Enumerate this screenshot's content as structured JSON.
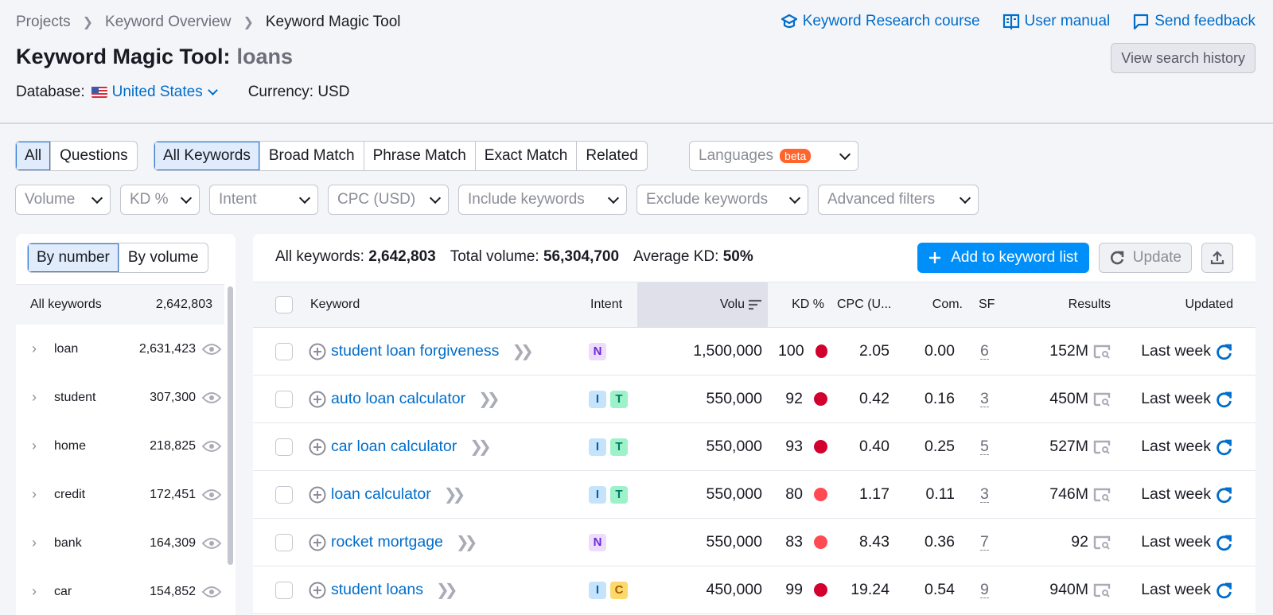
{
  "breadcrumbs": [
    "Projects",
    "Keyword Overview",
    "Keyword Magic Tool"
  ],
  "top_links": [
    {
      "label": "Keyword Research course",
      "icon": "graduation-cap-icon"
    },
    {
      "label": "User manual",
      "icon": "book-icon"
    },
    {
      "label": "Send feedback",
      "icon": "chat-bubble-icon"
    }
  ],
  "title": {
    "label": "Keyword Magic Tool:",
    "query": "loans"
  },
  "view_history_label": "View search history",
  "database": {
    "label": "Database:",
    "value": "United States",
    "currency": "Currency: USD"
  },
  "type_tabs": [
    {
      "label": "All",
      "active": true
    },
    {
      "label": "Questions",
      "active": false
    }
  ],
  "match_tabs": [
    {
      "label": "All Keywords",
      "active": true
    },
    {
      "label": "Broad Match",
      "active": false
    },
    {
      "label": "Phrase Match",
      "active": false
    },
    {
      "label": "Exact Match",
      "active": false
    },
    {
      "label": "Related",
      "active": false
    }
  ],
  "languages": {
    "label": "Languages",
    "badge": "beta"
  },
  "filters": [
    "Volume",
    "KD %",
    "Intent",
    "CPC (USD)",
    "Include keywords",
    "Exclude keywords",
    "Advanced filters"
  ],
  "left_panel": {
    "tabs": [
      {
        "label": "By number",
        "active": true
      },
      {
        "label": "By volume",
        "active": false
      }
    ],
    "all": {
      "label": "All keywords",
      "count": "2,642,803"
    },
    "groups": [
      {
        "label": "loan",
        "count": "2,631,423"
      },
      {
        "label": "student",
        "count": "307,300"
      },
      {
        "label": "home",
        "count": "218,825"
      },
      {
        "label": "credit",
        "count": "172,451"
      },
      {
        "label": "bank",
        "count": "164,309"
      },
      {
        "label": "car",
        "count": "154,852"
      }
    ]
  },
  "summary": {
    "all_label": "All keywords:",
    "all_value": "2,642,803",
    "vol_label": "Total volume:",
    "vol_value": "56,304,700",
    "kd_label": "Average KD:",
    "kd_value": "50%"
  },
  "actions": {
    "add": "Add to keyword list",
    "update": "Update"
  },
  "columns": {
    "keyword": "Keyword",
    "intent": "Intent",
    "volume": "Volu",
    "kd": "KD %",
    "cpc": "CPC (U...",
    "com": "Com.",
    "sf": "SF",
    "results": "Results",
    "updated": "Updated"
  },
  "colors": {
    "kd_very_hard": "#d1002f",
    "kd_hard": "#ff4953",
    "accent": "#008ff8",
    "link": "#006dca"
  },
  "rows": [
    {
      "keyword": "student loan forgiveness",
      "intents": [
        "N"
      ],
      "volume": "1,500,000",
      "kd": "100",
      "kd_level": "very_hard",
      "cpc": "2.05",
      "com": "0.00",
      "sf": "6",
      "results": "152M",
      "updated": "Last week"
    },
    {
      "keyword": "auto loan calculator",
      "intents": [
        "I",
        "T"
      ],
      "volume": "550,000",
      "kd": "92",
      "kd_level": "very_hard",
      "cpc": "0.42",
      "com": "0.16",
      "sf": "3",
      "results": "450M",
      "updated": "Last week"
    },
    {
      "keyword": "car loan calculator",
      "intents": [
        "I",
        "T"
      ],
      "volume": "550,000",
      "kd": "93",
      "kd_level": "very_hard",
      "cpc": "0.40",
      "com": "0.25",
      "sf": "5",
      "results": "527M",
      "updated": "Last week"
    },
    {
      "keyword": "loan calculator",
      "intents": [
        "I",
        "T"
      ],
      "volume": "550,000",
      "kd": "80",
      "kd_level": "hard",
      "cpc": "1.17",
      "com": "0.11",
      "sf": "3",
      "results": "746M",
      "updated": "Last week"
    },
    {
      "keyword": "rocket mortgage",
      "intents": [
        "N"
      ],
      "volume": "550,000",
      "kd": "83",
      "kd_level": "hard",
      "cpc": "8.43",
      "com": "0.36",
      "sf": "7",
      "results": "92",
      "updated": "Last week"
    },
    {
      "keyword": "student loans",
      "intents": [
        "I",
        "C"
      ],
      "volume": "450,000",
      "kd": "99",
      "kd_level": "very_hard",
      "cpc": "19.24",
      "com": "0.54",
      "sf": "9",
      "results": "940M",
      "updated": "Last week"
    }
  ]
}
